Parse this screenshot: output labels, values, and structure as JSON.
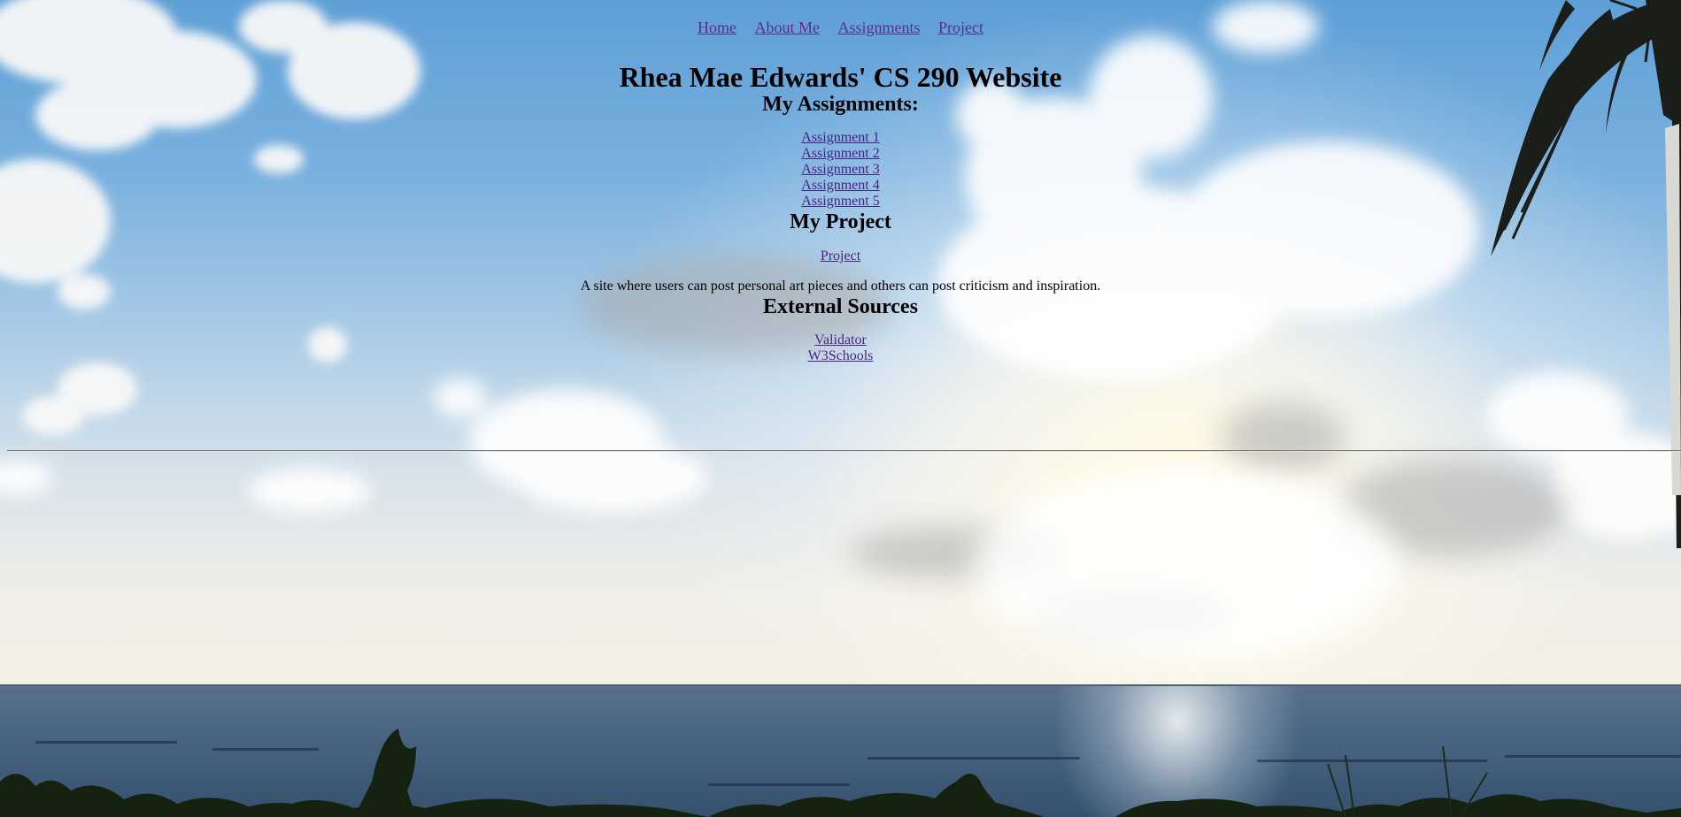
{
  "nav": {
    "links": [
      "Home",
      "About Me",
      "Assignments",
      "Project"
    ]
  },
  "page": {
    "title": "Rhea Mae Edwards' CS 290 Website"
  },
  "assignments": {
    "heading": "My Assignments:",
    "links": [
      "Assignment 1",
      "Assignment 2",
      "Assignment 3",
      "Assignment 4",
      "Assignment 5"
    ]
  },
  "project": {
    "heading": "My Project",
    "link": "Project",
    "description": "A site where users can post personal art pieces and others can post criticism and inspiration."
  },
  "sources": {
    "heading": "External Sources",
    "links": [
      "Validator",
      "W3Schools"
    ]
  },
  "colors": {
    "link": "#4b1f88",
    "visited_link": "#5a2e91",
    "text": "#000000"
  },
  "background": {
    "icon": "beach-sunset-background"
  }
}
